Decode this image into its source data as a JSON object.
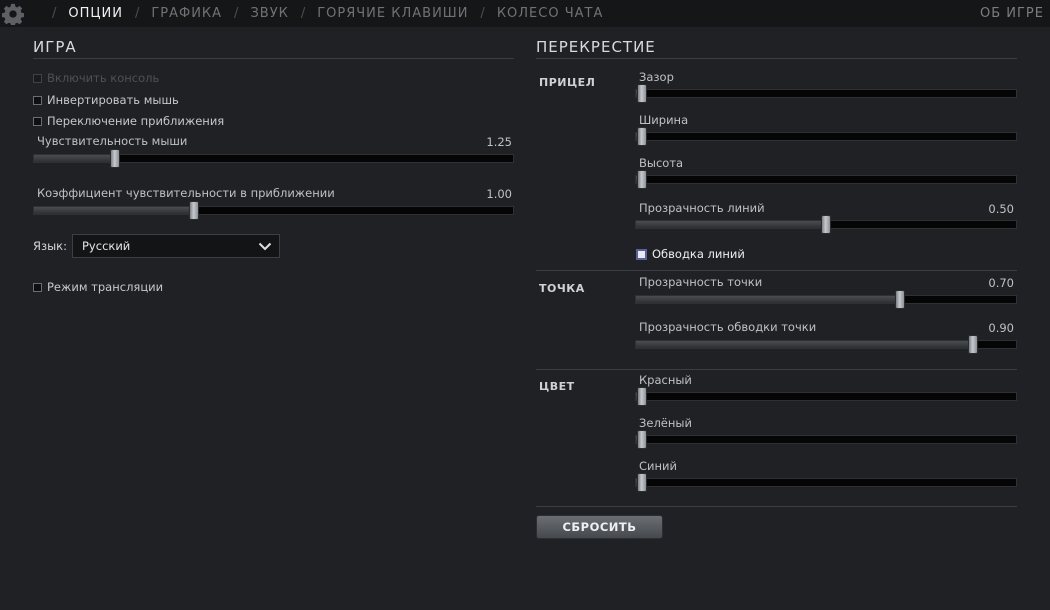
{
  "nav": {
    "tabs": [
      "ОПЦИИ",
      "ГРАФИКА",
      "ЗВУК",
      "ГОРЯЧИЕ КЛАВИШИ",
      "КОЛЕСО ЧАТА"
    ],
    "active": "ОПЦИИ",
    "about": "ОБ ИГРЕ"
  },
  "game": {
    "title": "ИГРА",
    "enable_console": {
      "label": "Включить консоль",
      "checked": false,
      "disabled": true
    },
    "invert_mouse": {
      "label": "Инвертировать мышь",
      "checked": false
    },
    "zoom_toggle": {
      "label": "Переключение приближения",
      "checked": false
    },
    "mouse_sensitivity": {
      "label": "Чувствительность мыши",
      "value": "1.25",
      "fraction": 0.16
    },
    "zoom_sensitivity": {
      "label": "Коэффициент чувствительности в приближении",
      "value": "1.00",
      "fraction": 0.33
    },
    "language": {
      "label": "Язык:",
      "value": "Русский"
    },
    "broadcast_mode": {
      "label": "Режим трансляции",
      "checked": false
    }
  },
  "crosshair": {
    "title": "ПЕРЕКРЕСТИЕ",
    "sight": {
      "label": "ПРИЦЕЛ",
      "gap": {
        "label": "Зазор",
        "fraction": 0.0
      },
      "width": {
        "label": "Ширина",
        "fraction": 0.0
      },
      "height": {
        "label": "Высота",
        "fraction": 0.0
      },
      "line_opacity": {
        "label": "Прозрачность линий",
        "value": "0.50",
        "fraction": 0.5
      },
      "line_outline": {
        "label": "Обводка линий",
        "checked": true
      }
    },
    "dot": {
      "label": "ТОЧКА",
      "dot_opacity": {
        "label": "Прозрачность точки",
        "value": "0.70",
        "fraction": 0.7
      },
      "dot_outline_opacity": {
        "label": "Прозрачность обводки точки",
        "value": "0.90",
        "fraction": 0.9
      }
    },
    "color": {
      "label": "ЦВЕТ",
      "red": {
        "label": "Красный",
        "fraction": 0.0
      },
      "green": {
        "label": "Зелёный",
        "fraction": 0.0
      },
      "blue": {
        "label": "Синий",
        "fraction": 0.0
      }
    },
    "reset_label": "СБРОСИТЬ"
  }
}
